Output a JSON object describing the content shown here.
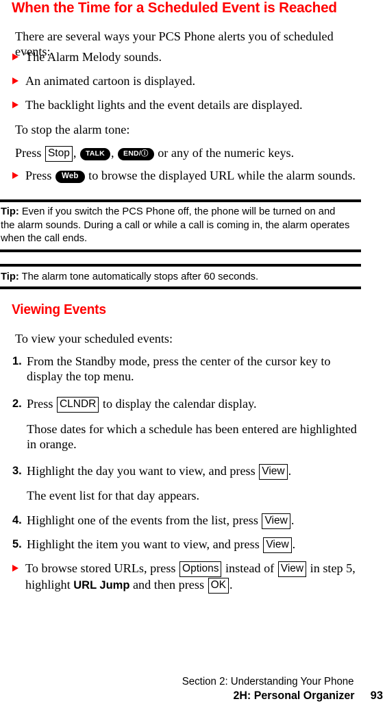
{
  "headings": {
    "main": "When the Time for a Scheduled Event is Reached",
    "section": "Viewing Events"
  },
  "intro": {
    "lead": "There are several ways your PCS Phone alerts you of scheduled events:",
    "bullets": [
      "The Alarm Melody sounds.",
      "An animated cartoon is displayed.",
      "The backlight lights and the event details are displayed."
    ]
  },
  "stop_alarm": {
    "lead": "To stop the alarm tone:",
    "press_prefix": "Press",
    "comma1": ",",
    "comma2": ",",
    "press_suffix": "or any of the numeric keys.",
    "web_bullet_prefix": "Press",
    "web_bullet_suffix": "to browse the displayed URL while the alarm sounds."
  },
  "keys": {
    "stop": "Stop",
    "talk": "TALK",
    "end": "END/ⓘ",
    "web": "Web",
    "clndr": "CLNDR",
    "view": "View",
    "options": "Options",
    "ok": "OK"
  },
  "tips": [
    {
      "label": "Tip:",
      "text": "Even if you switch the PCS Phone off, the phone will be turned on and the alarm sounds. During a call or while a call is coming in, the alarm operates when the call ends."
    },
    {
      "label": "Tip:",
      "text": "The alarm tone automatically stops after 60 seconds."
    }
  ],
  "viewing": {
    "lead": "To view your scheduled events:",
    "steps": [
      {
        "num": "1.",
        "text": "From the Standby mode, press the center of the cursor key to display the top menu."
      },
      {
        "num": "2.",
        "prefix": "Press",
        "suffix": "to display the calendar display."
      },
      {
        "num": "3.",
        "prefix": "Highlight the day you want to view, and press",
        "suffix": "."
      },
      {
        "num": "4.",
        "prefix": "Highlight one of the events from the list, press",
        "suffix": "."
      },
      {
        "num": "5.",
        "prefix": "Highlight the item you want to view, and press",
        "suffix": "."
      }
    ],
    "note_after_step2": "Those dates for which a schedule has been entered are highlighted in orange.",
    "note_after_step3": "The event list for that day appears.",
    "url_bullet": {
      "part1": "To browse stored URLs, press",
      "part2": "instead of",
      "part3": "in step 5, highlight",
      "bold_term": "URL Jump",
      "part4": "and then press",
      "part5": "."
    }
  },
  "footer": {
    "section": "Section 2: Understanding Your Phone",
    "chapter": "2H: Personal Organizer",
    "page": "93"
  },
  "colors": {
    "heading_red": "#FF0000",
    "bullet_red": "#FF0000",
    "rule_black": "#000000",
    "text_black": "#000000"
  }
}
